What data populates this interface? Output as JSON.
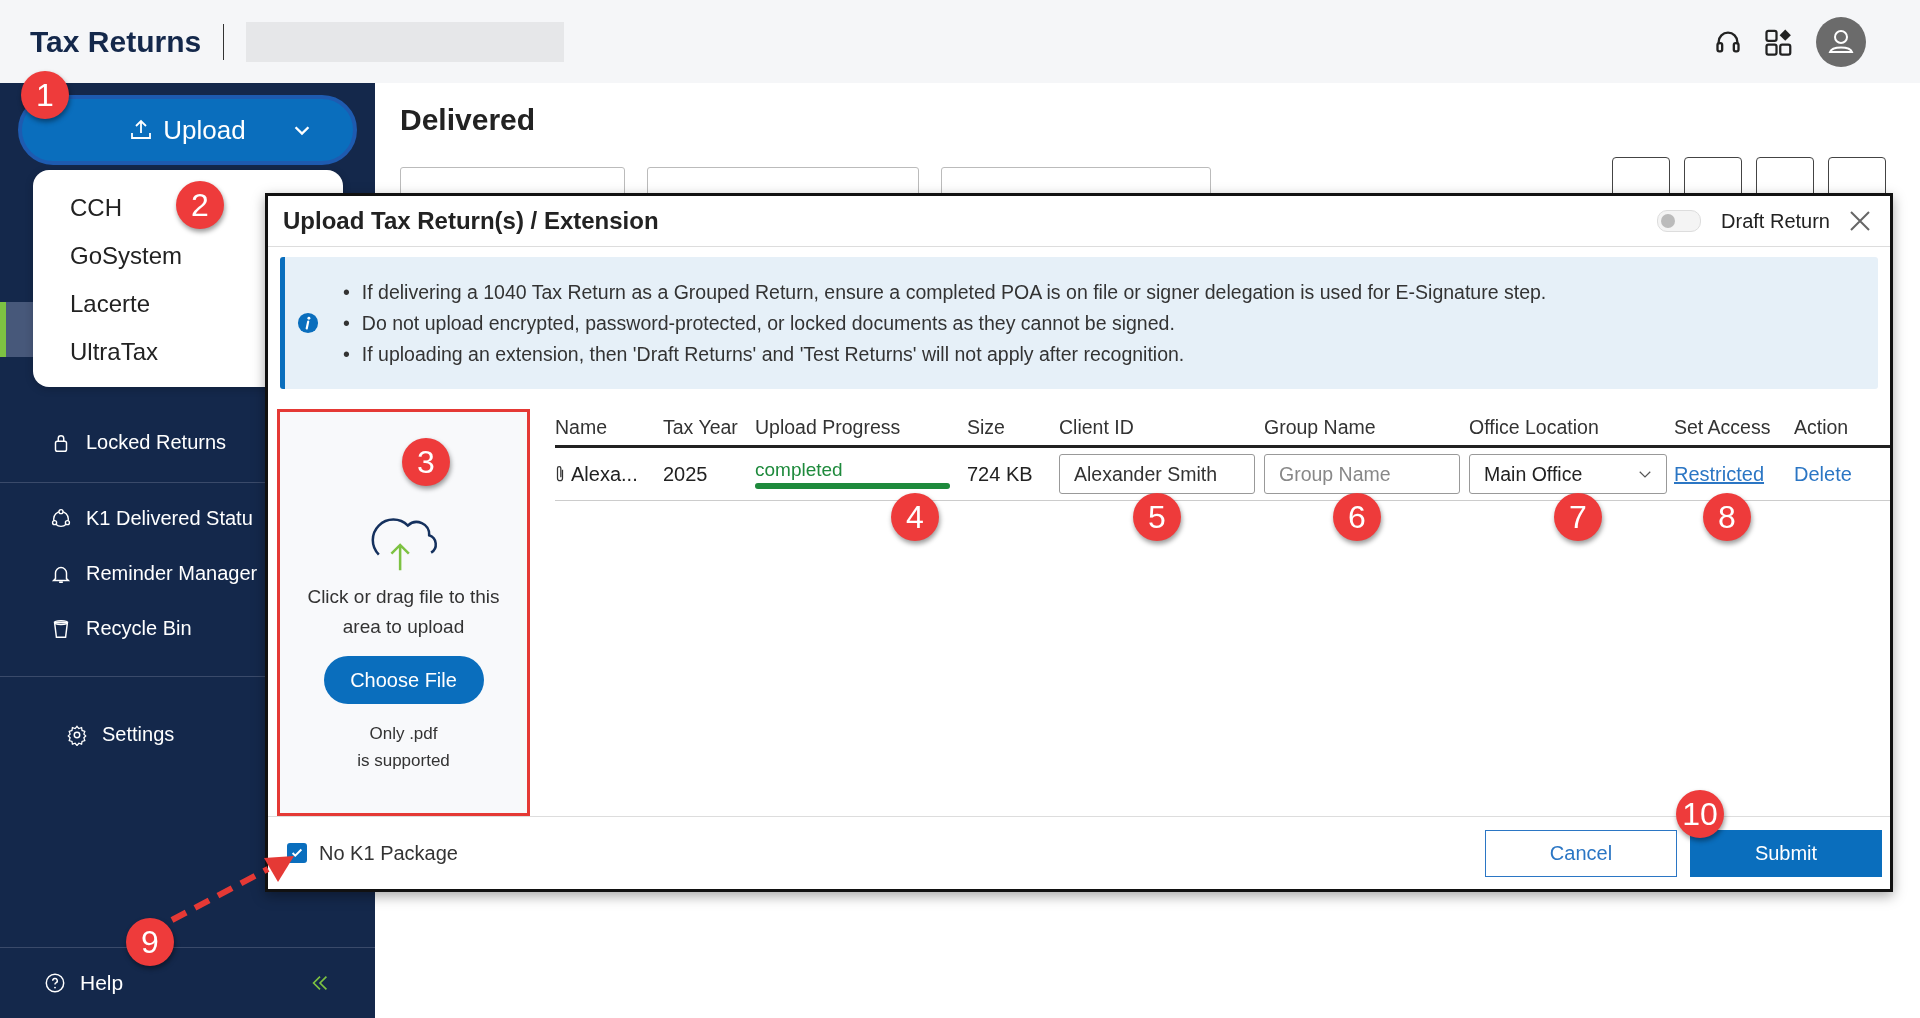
{
  "header": {
    "title": "Tax Returns"
  },
  "upload_button": {
    "label": "Upload"
  },
  "upload_menu": {
    "items": [
      "CCH",
      "GoSystem",
      "Lacerte",
      "UltraTax"
    ]
  },
  "sidebar": {
    "groups": [
      {
        "items": [
          {
            "selected": true
          },
          {
            "label": "Locked Returns",
            "selected": false
          }
        ]
      },
      {
        "items": [
          {
            "label": "K1 Delivered Statu",
            "selected": false
          },
          {
            "label": "Reminder Manager",
            "selected": false
          },
          {
            "label": "Recycle Bin",
            "selected": false
          }
        ]
      },
      {
        "items": [
          {
            "label": "Settings",
            "selected": false
          }
        ]
      }
    ],
    "help": "Help"
  },
  "page": {
    "title": "Delivered"
  },
  "dialog": {
    "title": "Upload Tax Return(s) / Extension",
    "draft_return": {
      "label": "Draft Return",
      "on": false
    },
    "notes": [
      {
        "bullet": "•",
        "text": "If delivering a 1040 Tax Return as a Grouped Return, ensure a completed POA is on file or signer delegation is used for E-Signature step."
      },
      {
        "bullet": "•",
        "text": "Do not upload encrypted, password-protected, or locked documents as they cannot be signed."
      },
      {
        "bullet": "•",
        "text": "If uploading an extension, then 'Draft Returns' and 'Test Returns' will not apply after recognition."
      }
    ],
    "drop_zone": {
      "text": "Click or drag file to this area to upload",
      "button": "Choose File",
      "hint_lines": [
        "Only .pdf",
        "is supported"
      ]
    },
    "table": {
      "columns": [
        "Name",
        "Tax Year",
        "Upload Progress",
        "Size",
        "Client ID",
        "Group Name",
        "Office Location",
        "Set Access",
        "Action"
      ],
      "rows": [
        {
          "name": "Alexa...",
          "tax_year": "2025",
          "progress": {
            "status": "completed",
            "level": 1
          },
          "size": "724 KB",
          "client_id": "Alexander Smith",
          "group_name": {
            "placeholder": "Group Name"
          },
          "office_location": "Main Office",
          "set_access": "Restricted",
          "action": "Delete"
        }
      ]
    },
    "no_k1_package": {
      "label": "No K1 Package",
      "checked": true
    },
    "buttons": {
      "cancel": "Cancel",
      "submit": "Submit"
    }
  },
  "annotations": [
    "1",
    "2",
    "3",
    "4",
    "5",
    "6",
    "7",
    "8",
    "9",
    "10"
  ]
}
